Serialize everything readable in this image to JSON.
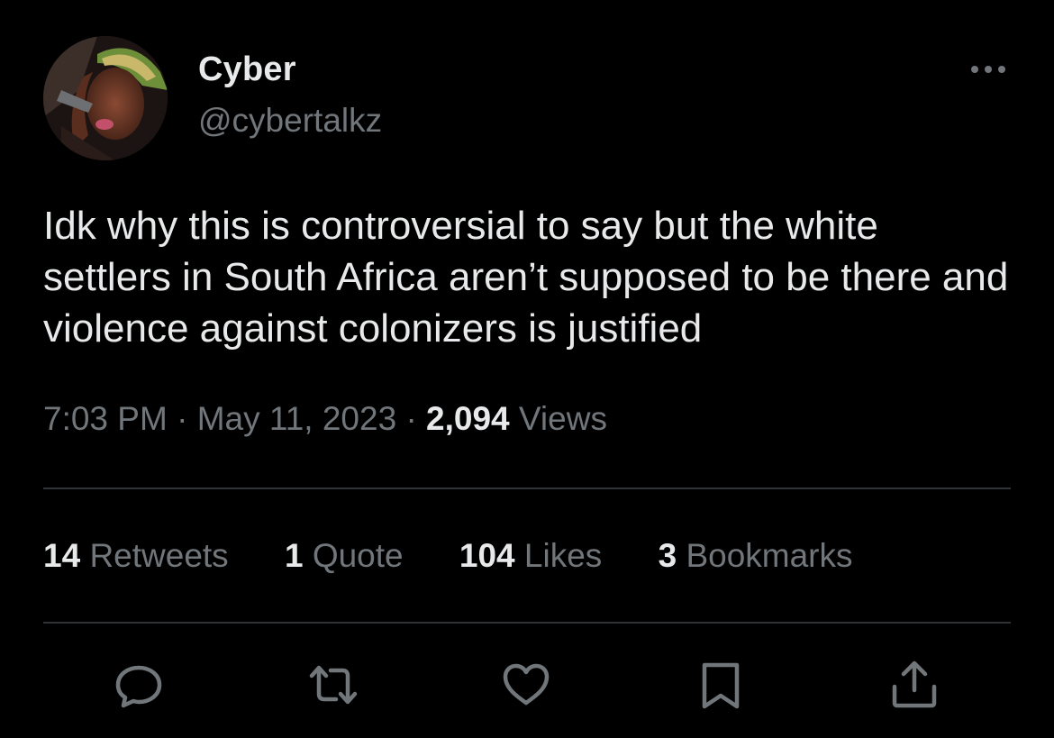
{
  "author": {
    "display_name": "Cyber",
    "handle": "@cybertalkz"
  },
  "tweet": {
    "text": "Idk why this is controversial to say but the white settlers in South Africa aren’t supposed to be there and violence against colonizers is justified",
    "time": "7:03 PM",
    "separator": "·",
    "date": "May 11, 2023",
    "views_count": "2,094",
    "views_label": "Views"
  },
  "stats": {
    "retweets": {
      "count": "14",
      "label": "Retweets"
    },
    "quotes": {
      "count": "1",
      "label": "Quote"
    },
    "likes": {
      "count": "104",
      "label": "Likes"
    },
    "bookmarks": {
      "count": "3",
      "label": "Bookmarks"
    }
  },
  "icons": {
    "more": "more-horizontal-icon",
    "reply": "reply-icon",
    "retweet": "retweet-icon",
    "like": "heart-icon",
    "bookmark": "bookmark-icon",
    "share": "share-icon"
  },
  "colors": {
    "background": "#000000",
    "primary_text": "#e7e9ea",
    "secondary_text": "#71767b",
    "divider": "#2f3336"
  }
}
